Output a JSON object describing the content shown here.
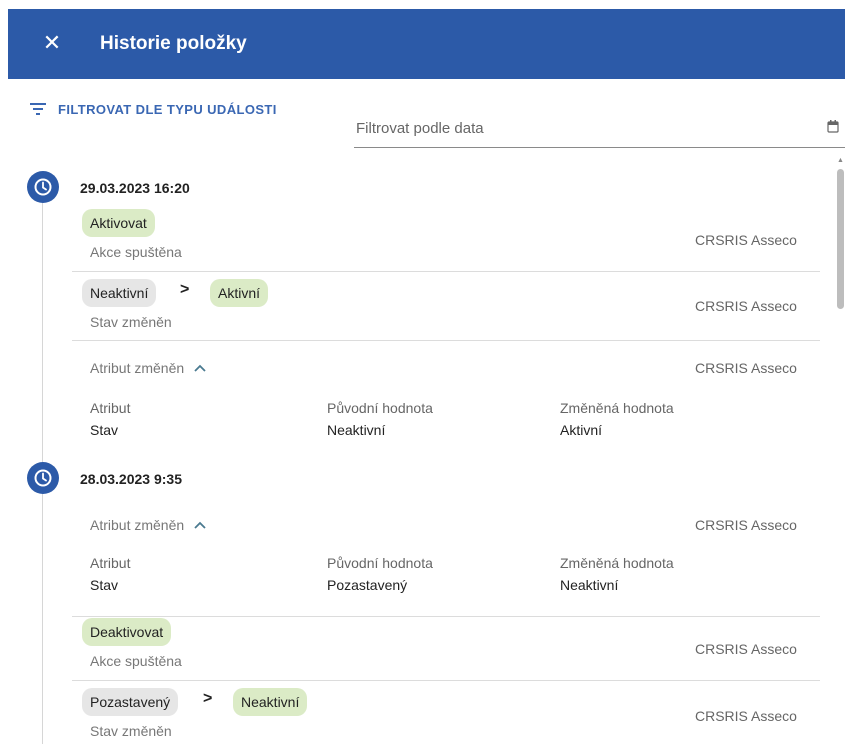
{
  "header": {
    "title": "Historie položky",
    "close_icon": "close-icon"
  },
  "filters": {
    "event_type_label": "FILTROVAT DLE TYPU UDÁLOSTI",
    "date_placeholder": "Filtrovat podle data"
  },
  "columns": {
    "attribute": "Atribut",
    "original": "Původní hodnota",
    "changed": "Změněná hodnota"
  },
  "groups": [
    {
      "date": "29.03.2023 16:20",
      "events": [
        {
          "chip": "Aktivovat",
          "subtitle": "Akce spuštěna",
          "user": "CRSRIS Asseco"
        },
        {
          "from": "Neaktivní",
          "to": "Aktivní",
          "subtitle": "Stav změněn",
          "user": "CRSRIS Asseco"
        },
        {
          "toggle": "Atribut změněn",
          "user": "CRSRIS Asseco",
          "attribute": "Stav",
          "original": "Neaktivní",
          "changed": "Aktivní"
        }
      ]
    },
    {
      "date": "28.03.2023 9:35",
      "events": [
        {
          "toggle": "Atribut změněn",
          "user": "CRSRIS Asseco",
          "attribute": "Stav",
          "original": "Pozastavený",
          "changed": "Neaktivní"
        },
        {
          "chip": "Deaktivovat",
          "subtitle": "Akce spuštěna",
          "user": "CRSRIS Asseco"
        },
        {
          "from": "Pozastavený",
          "to": "Neaktivní",
          "subtitle": "Stav změněn",
          "user": "CRSRIS Asseco"
        }
      ]
    }
  ],
  "colors": {
    "primary": "#2c5aa8",
    "chip_green": "#dbebc6",
    "chip_grey": "#e6e6e6"
  }
}
